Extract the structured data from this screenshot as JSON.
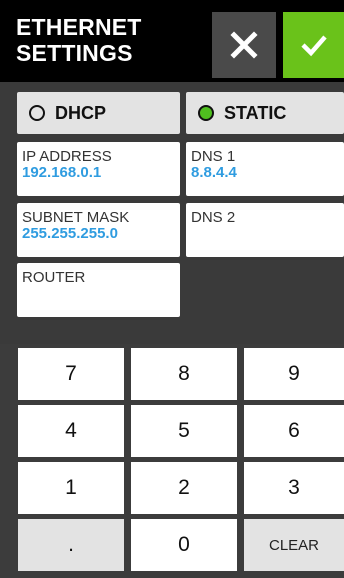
{
  "header": {
    "title_line1": "ETHERNET",
    "title_line2": "SETTINGS"
  },
  "mode": {
    "dhcp_label": "DHCP",
    "static_label": "STATIC",
    "selected": "STATIC"
  },
  "fields": {
    "ip_address": {
      "label": "IP ADDRESS",
      "value": "192.168.0.1"
    },
    "dns1": {
      "label": "DNS 1",
      "value": "8.8.4.4"
    },
    "subnet_mask": {
      "label": "SUBNET MASK",
      "value": "255.255.255.0"
    },
    "dns2": {
      "label": "DNS 2",
      "value": ""
    },
    "router": {
      "label": "ROUTER",
      "value": ""
    }
  },
  "keypad": {
    "keys": [
      "7",
      "8",
      "9",
      "4",
      "5",
      "6",
      "1",
      "2",
      "3",
      ".",
      "0",
      "CLEAR"
    ]
  },
  "colors": {
    "accent_green": "#6ac21a",
    "value_blue": "#2f9ce0",
    "header_bg": "#000000"
  },
  "icons": {
    "cancel": "close-icon",
    "confirm": "check-icon"
  }
}
